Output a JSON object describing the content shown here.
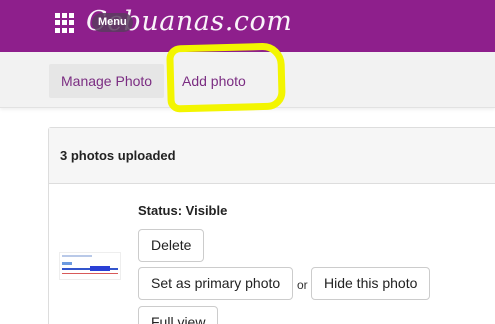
{
  "header": {
    "logo_text": "Cebuanas.com",
    "menu_label": "Menu",
    "brand_color": "#8e1f8c",
    "grid_icon": "apps-grid-icon"
  },
  "tabs": {
    "manage_label": "Manage Photo",
    "add_label": "Add photo"
  },
  "card": {
    "title": "3 photos uploaded",
    "status": "Status: Visible",
    "delete_label": "Delete",
    "set_primary_label": "Set as primary photo",
    "or_text": "or",
    "hide_label": "Hide this photo",
    "full_view_label": "Full view"
  },
  "annotation": {
    "highlight_color": "#f3f500"
  }
}
